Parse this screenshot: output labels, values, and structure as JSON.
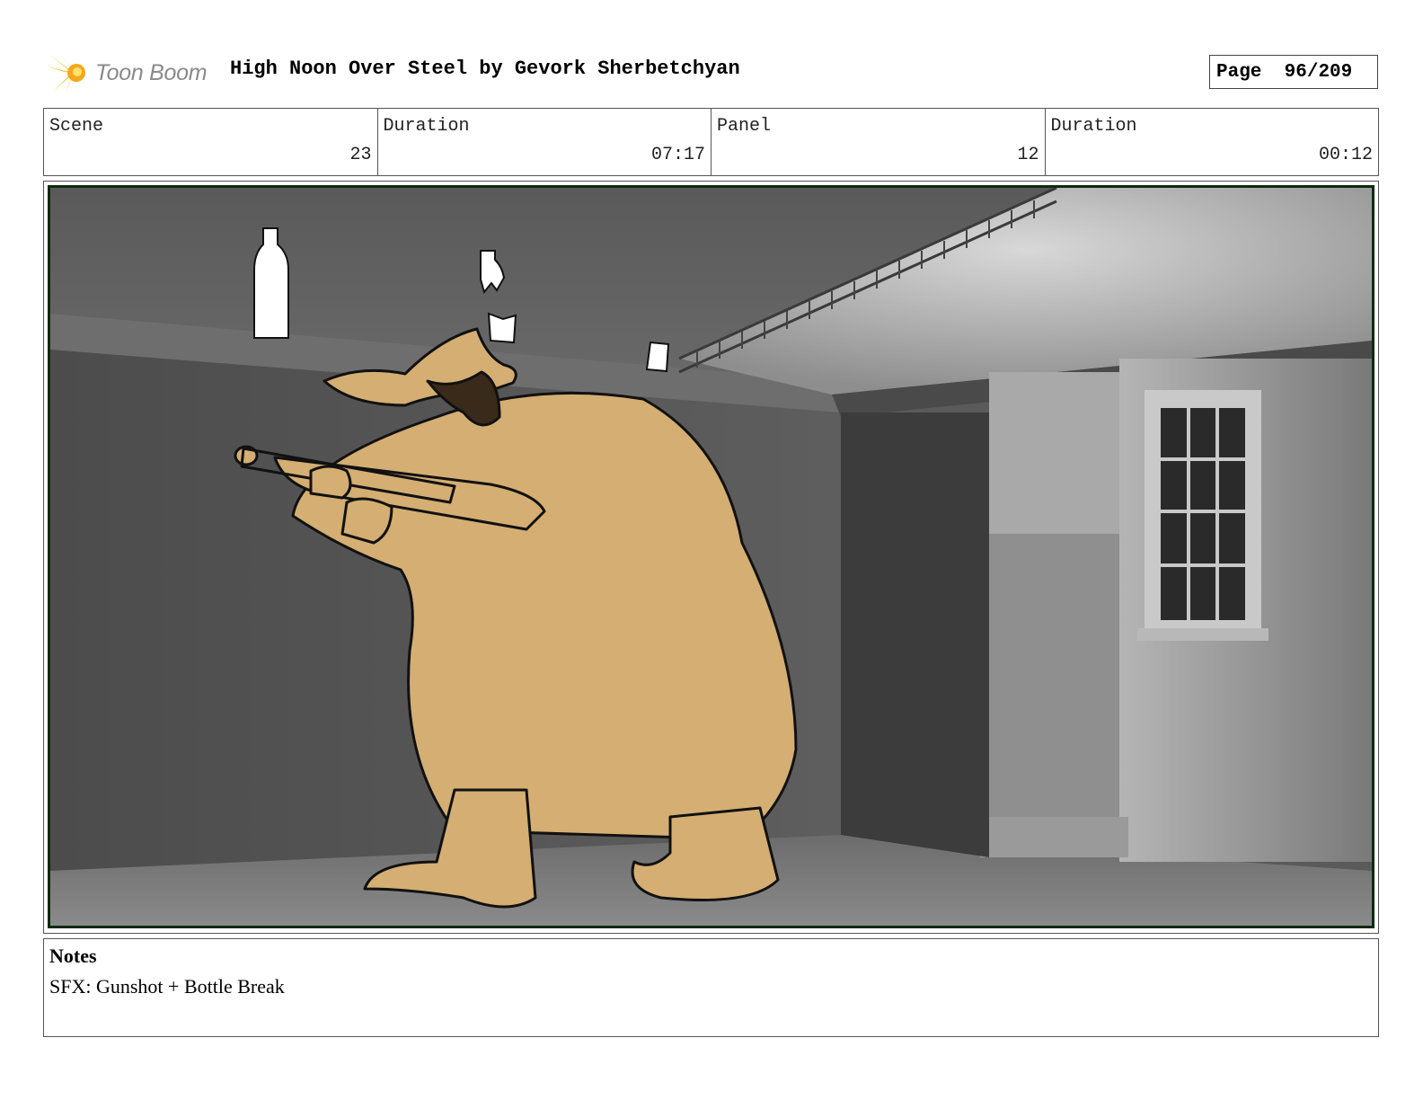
{
  "header": {
    "logo_text": "Toon Boom",
    "title": "High Noon Over Steel by Gevork Sherbetchyan",
    "page_label": "Page",
    "page_value": "96/209"
  },
  "info": {
    "scene_label": "Scene",
    "scene_value": "23",
    "scene_duration_label": "Duration",
    "scene_duration_value": "07:17",
    "panel_label": "Panel",
    "panel_value": "12",
    "panel_duration_label": "Duration",
    "panel_duration_value": "00:12"
  },
  "notes": {
    "title": "Notes",
    "text": "SFX: Gunshot + Bottle Break"
  },
  "colors": {
    "coat": "#d4ae72",
    "frame": "#0d2a0d",
    "logo_flare": "#f5c21b"
  }
}
